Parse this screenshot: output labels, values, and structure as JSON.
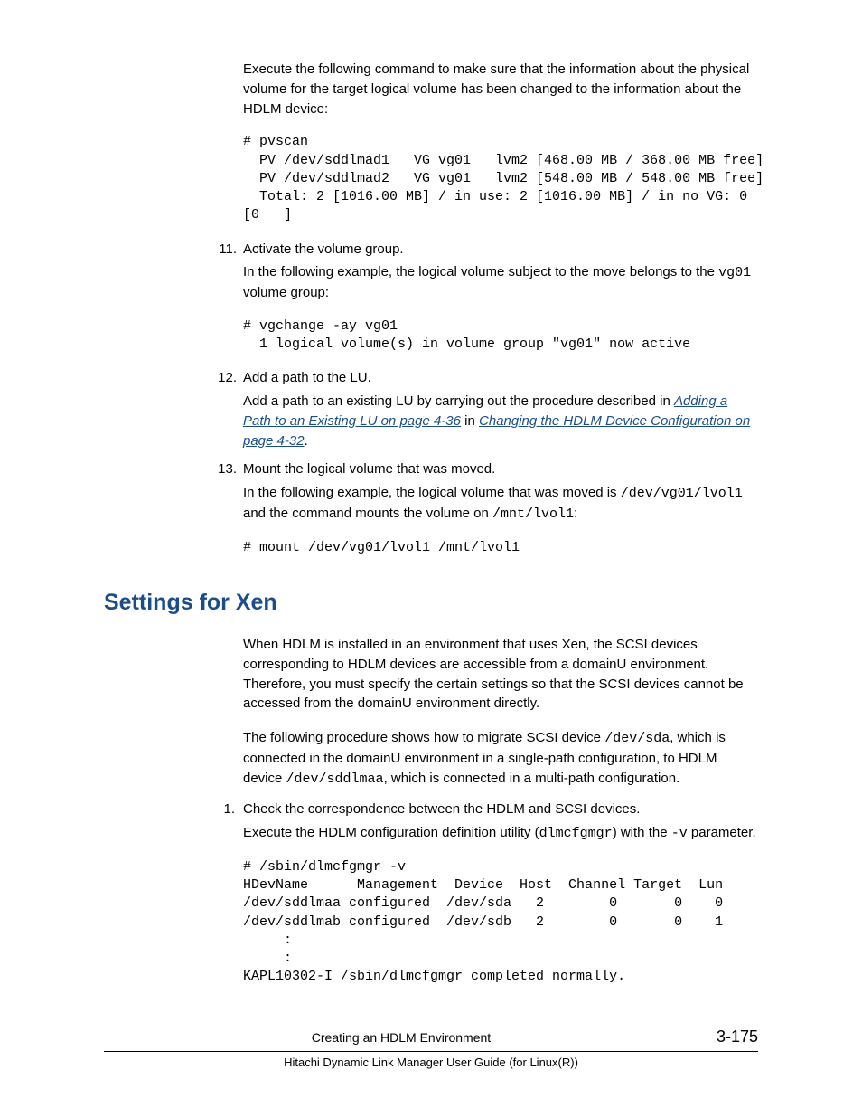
{
  "intro_paragraph": "Execute the following command to make sure that the information about the physical volume for the target logical volume has been changed to the information about the HDLM device:",
  "code_pvscan": "# pvscan\n  PV /dev/sddlmad1   VG vg01   lvm2 [468.00 MB / 368.00 MB free]\n  PV /dev/sddlmad2   VG vg01   lvm2 [548.00 MB / 548.00 MB free]\n  Total: 2 [1016.00 MB] / in use: 2 [1016.00 MB] / in no VG: 0 \n[0   ]",
  "steps_top": [
    {
      "num": "11.",
      "lead": "Activate the volume group.",
      "body_pre": "In the following example, the logical volume subject to the move belongs to the ",
      "body_code1": "vg01",
      "body_post": " volume group:",
      "code": "# vgchange -ay vg01\n  1 logical volume(s) in volume group \"vg01\" now active"
    },
    {
      "num": "12.",
      "lead": "Add a path to the LU.",
      "body_pre": "Add a path to an existing LU by carrying out the procedure described in ",
      "link1": "Adding a Path to an Existing LU on page 4-36",
      "mid": " in ",
      "link2": "Changing the HDLM Device Configuration on page 4-32",
      "body_post2": "."
    },
    {
      "num": "13.",
      "lead": "Mount the logical volume that was moved.",
      "b1": "In the following example, the logical volume that was moved is ",
      "c1": "/dev/vg01/lvol1",
      "b2": " and the command mounts the volume on ",
      "c2": "/mnt/lvol1",
      "b3": ":",
      "code": "# mount /dev/vg01/lvol1 /mnt/lvol1"
    }
  ],
  "section_heading": "Settings for Xen",
  "xen_para1": "When HDLM is installed in an environment that uses Xen, the SCSI devices corresponding to HDLM devices are accessible from a domainU environment. Therefore, you must specify the certain settings so that the SCSI devices cannot be accessed from the domainU environment directly.",
  "xen_para2_a": "The following procedure shows how to migrate SCSI device ",
  "xen_para2_c1": "/dev/sda",
  "xen_para2_b": ", which is connected in the domainU environment in a single-path configuration, to HDLM device ",
  "xen_para2_c2": "/dev/sddlmaa",
  "xen_para2_c": ", which is connected in a multi-path configuration.",
  "steps_bottom": [
    {
      "num": "1.",
      "lead": "Check the correspondence between the HDLM and SCSI devices.",
      "b1": "Execute the HDLM configuration definition utility (",
      "c1": "dlmcfgmgr",
      "b2": ") with the ",
      "c2": "-v",
      "b3": " parameter.",
      "code": "# /sbin/dlmcfgmgr -v\nHDevName      Management  Device  Host  Channel Target  Lun\n/dev/sddlmaa configured  /dev/sda   2        0       0    0\n/dev/sddlmab configured  /dev/sdb   2        0       0    1\n     :\n     :\nKAPL10302-I /sbin/dlmcfgmgr completed normally."
    }
  ],
  "footer_title": "Creating an HDLM Environment",
  "page_number": "3-175",
  "footer_sub": "Hitachi Dynamic Link Manager User Guide (for Linux(R))"
}
